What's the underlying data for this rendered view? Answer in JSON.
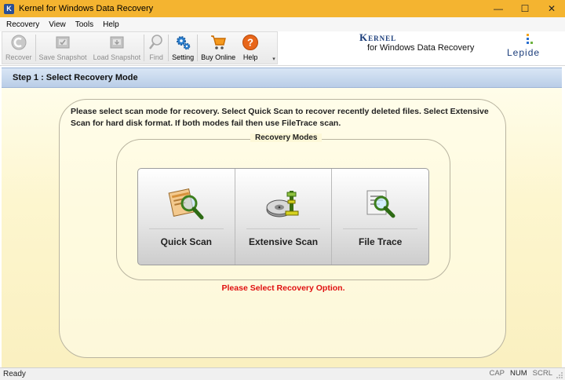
{
  "window": {
    "title": "Kernel for Windows Data Recovery",
    "icon_letter": "K",
    "controls": {
      "minimize": "—",
      "maximize": "☐",
      "close": "✕"
    }
  },
  "menu": [
    "Recovery",
    "View",
    "Tools",
    "Help"
  ],
  "toolbar": {
    "recover": "Recover",
    "save_snapshot": "Save Snapshot",
    "load_snapshot": "Load Snapshot",
    "find": "Find",
    "setting": "Setting",
    "buy_online": "Buy Online",
    "help": "Help",
    "overflow": "▾"
  },
  "brand": {
    "kernel": "Kernel",
    "subtitle": "for Windows Data Recovery",
    "lepide": "Lepide"
  },
  "step": {
    "title": "Step 1 : Select Recovery Mode"
  },
  "main": {
    "instructions": "Please select scan mode for recovery. Select Quick Scan to recover recently deleted files. Select Extensive Scan for hard disk format. If both modes fail then use FileTrace scan.",
    "modes_title": "Recovery Modes",
    "modes": [
      {
        "label": "Quick Scan",
        "icon": "quick-scan-icon"
      },
      {
        "label": "Extensive Scan",
        "icon": "extensive-scan-icon"
      },
      {
        "label": "File Trace",
        "icon": "file-trace-icon"
      }
    ],
    "status_message": "Please Select Recovery Option."
  },
  "statusbar": {
    "ready": "Ready",
    "cap": "CAP",
    "num": "NUM",
    "scrl": "SCRL"
  },
  "colors": {
    "titlebar": "#f4b430",
    "alert": "#e01010",
    "brand_blue": "#1a3c7a"
  }
}
